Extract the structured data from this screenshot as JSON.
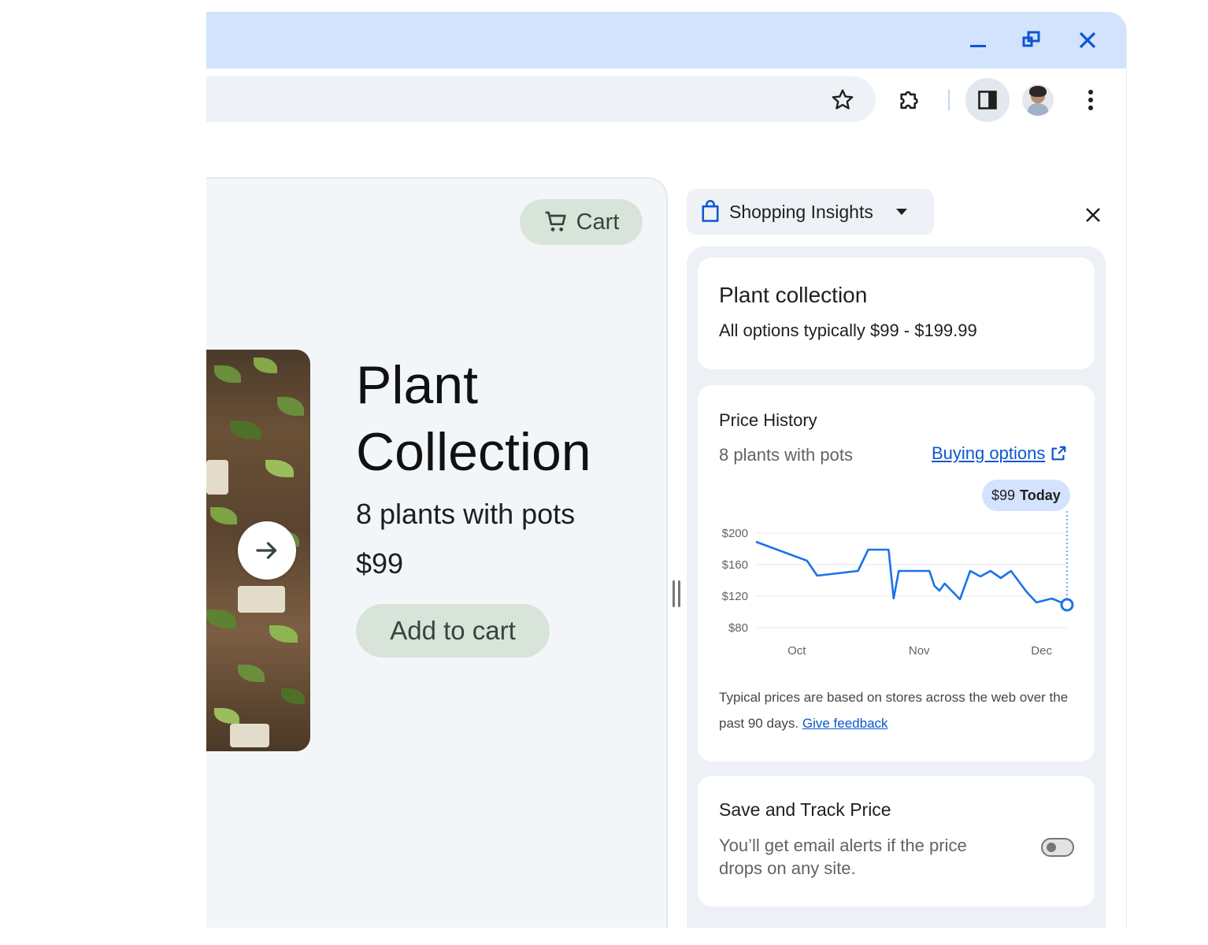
{
  "icons": {
    "minimize": "minimize-icon",
    "restore": "restore-icon",
    "close": "close-icon",
    "bookmark": "star-icon",
    "extensions": "puzzle-icon",
    "side_panel": "side-panel-icon",
    "menu": "more-vert-icon",
    "cart": "cart-icon",
    "next": "arrow-right-icon",
    "shopping": "shopping-bag-icon",
    "dropdown": "caret-down-icon",
    "external": "open-external-icon"
  },
  "colors": {
    "titlebar": "#d3e3fd",
    "accent": "#0b57d0",
    "button_green": "#d8e3da",
    "chart_line": "#1a73e8"
  },
  "product": {
    "cart_label": "Cart",
    "title": "Plant Collection",
    "subtitle": "8 plants with pots",
    "price": "$99",
    "add_to_cart": "Add to cart"
  },
  "side_panel": {
    "header_label": "Shopping Insights",
    "summary": {
      "title": "Plant collection",
      "range": "All options typically $99 - $199.99"
    },
    "price_history": {
      "title": "Price History",
      "subtitle": "8 plants with pots",
      "buying_options": "Buying options",
      "today_price": "$99",
      "today_label": "Today",
      "footnote": "Typical prices are based on stores across the web over the past 90 days.",
      "feedback_link": "Give feedback"
    },
    "track": {
      "title": "Save and Track Price",
      "description": "You’ll get email alerts if the price drops on any site.",
      "enabled": false
    }
  },
  "chart_data": {
    "type": "line",
    "title": "",
    "xlabel": "",
    "ylabel": "",
    "y_ticks": [
      "$200",
      "$160",
      "$120",
      "$80"
    ],
    "x_ticks": [
      "Oct",
      "Nov",
      "Dec"
    ],
    "ylim": [
      80,
      200
    ],
    "grid": true,
    "series": [
      {
        "name": "",
        "points": [
          [
            0,
            189
          ],
          [
            5,
            177
          ],
          [
            10,
            165
          ],
          [
            12,
            146
          ],
          [
            20,
            152
          ],
          [
            22,
            179
          ],
          [
            26,
            179
          ],
          [
            27,
            117
          ],
          [
            28,
            152
          ],
          [
            34,
            152
          ],
          [
            35,
            133
          ],
          [
            36,
            127
          ],
          [
            37,
            136
          ],
          [
            40,
            116
          ],
          [
            42,
            152
          ],
          [
            44,
            145
          ],
          [
            46,
            152
          ],
          [
            48,
            143
          ],
          [
            50,
            152
          ],
          [
            53,
            126
          ],
          [
            55,
            112
          ],
          [
            58,
            117
          ],
          [
            61,
            109
          ]
        ]
      }
    ],
    "x_tick_positions": [
      8,
      32,
      56
    ],
    "x_range": [
      0,
      61
    ],
    "highlight_last": true
  }
}
